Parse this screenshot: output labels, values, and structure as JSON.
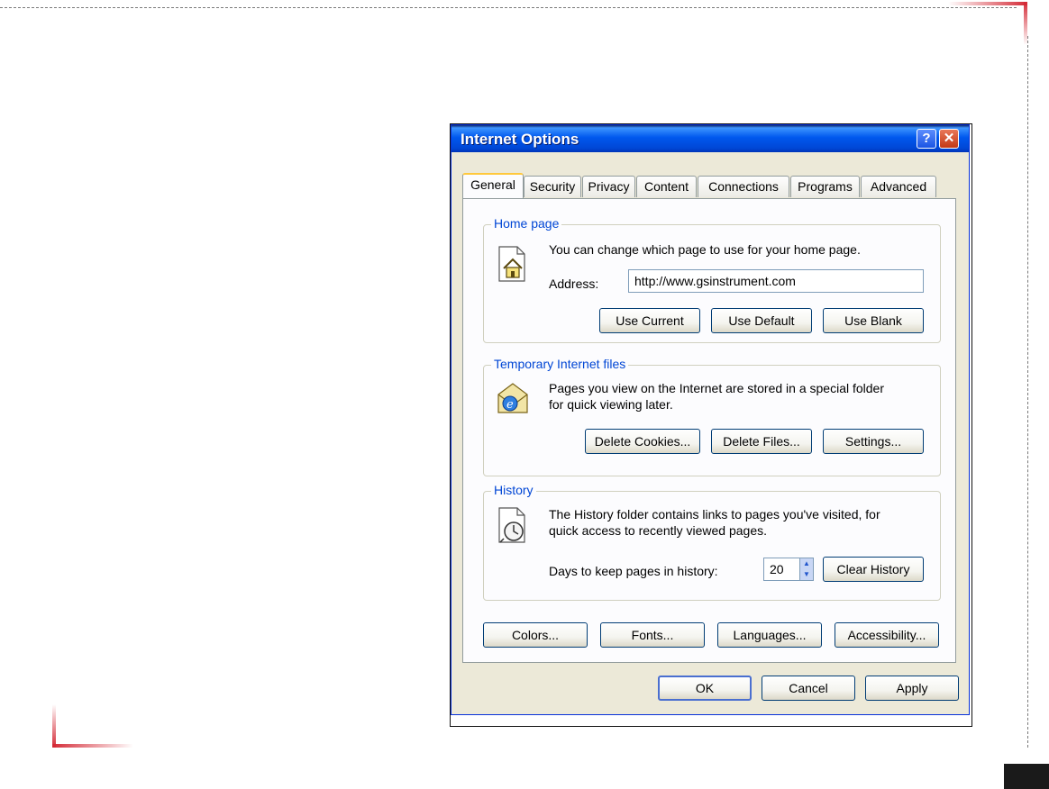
{
  "window": {
    "title": "Internet Options",
    "help_label": "?",
    "close_label": "✕"
  },
  "tabs": [
    {
      "label": "General",
      "active": true
    },
    {
      "label": "Security"
    },
    {
      "label": "Privacy"
    },
    {
      "label": "Content"
    },
    {
      "label": "Connections"
    },
    {
      "label": "Programs"
    },
    {
      "label": "Advanced"
    }
  ],
  "home_page": {
    "group_label": "Home page",
    "description": "You can change which page to use for your home page.",
    "address_label": "Address:",
    "address_value": "http://www.gsinstrument.com",
    "buttons": {
      "use_current": "Use Current",
      "use_default": "Use Default",
      "use_blank": "Use Blank"
    }
  },
  "temp_files": {
    "group_label": "Temporary Internet files",
    "description_line1": "Pages you view on the Internet are stored in a special folder",
    "description_line2": "for quick viewing later.",
    "buttons": {
      "delete_cookies": "Delete Cookies...",
      "delete_files": "Delete Files...",
      "settings": "Settings..."
    }
  },
  "history": {
    "group_label": "History",
    "description_line1": "The History folder contains links to pages you've visited, for",
    "description_line2": "quick access to recently viewed pages.",
    "days_label": "Days to keep pages in history:",
    "days_value": "20",
    "clear_button": "Clear History"
  },
  "bottom_buttons": {
    "colors": "Colors...",
    "fonts": "Fonts...",
    "languages": "Languages...",
    "accessibility": "Accessibility..."
  },
  "dialog_buttons": {
    "ok": "OK",
    "cancel": "Cancel",
    "apply": "Apply"
  },
  "icons": {
    "home_page": "home-page-icon",
    "temp_files": "ie-folder-icon",
    "history": "history-clock-icon"
  },
  "colors": {
    "title_bar": "#0058ee",
    "dialog_bg": "#ECE9D8",
    "group_label": "#0046d5",
    "accent_red": "#d42a36"
  }
}
